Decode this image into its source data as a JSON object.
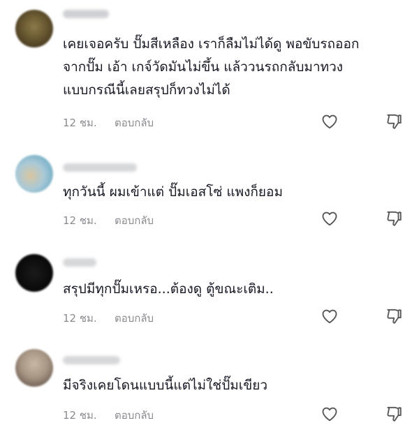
{
  "comments": [
    {
      "lines": [
        "เคยเจอครับ ปั๊มสีเหลือง เราก็ลืมไม่ได้ดู พอขับรถออก",
        "จากปั๊ม เอ้า เกจ์วัดมันไม่ขึ้น แล้ววนรถกลับมาทวง",
        "แบบกรณีนี้เลยสรุปก็ทวงไม่ได้"
      ],
      "time": "12 ชม.",
      "reply_label": "ตอบกลับ",
      "like_icon": "heart-outline-icon",
      "dislike_icon": "thumbs-down-outline-icon"
    },
    {
      "lines": [
        "ทุกวันนี้ ผมเข้าแต่ ปั๊มเอสโซ่ แพงก็ยอม"
      ],
      "time": "12 ชม.",
      "reply_label": "ตอบกลับ",
      "like_icon": "heart-outline-icon",
      "dislike_icon": "thumbs-down-outline-icon"
    },
    {
      "lines": [
        "สรุปมีทุกปั๊มเหรอ...ต้องดู ตู้ขณะเติม.."
      ],
      "time": "12 ชม.",
      "reply_label": "ตอบกลับ",
      "like_icon": "heart-outline-icon",
      "dislike_icon": "thumbs-down-outline-icon"
    },
    {
      "lines": [
        "มีจริงเคยโดนแบบนี้แต่ไม่ใช่ปั๊มเขียว"
      ],
      "time": "12 ชม.",
      "reply_label": "ตอบกลับ",
      "like_icon": "heart-outline-icon",
      "dislike_icon": "thumbs-down-outline-icon"
    }
  ],
  "colors": {
    "text": "#161823",
    "meta": "#8a8b91",
    "icon": "#555555"
  }
}
